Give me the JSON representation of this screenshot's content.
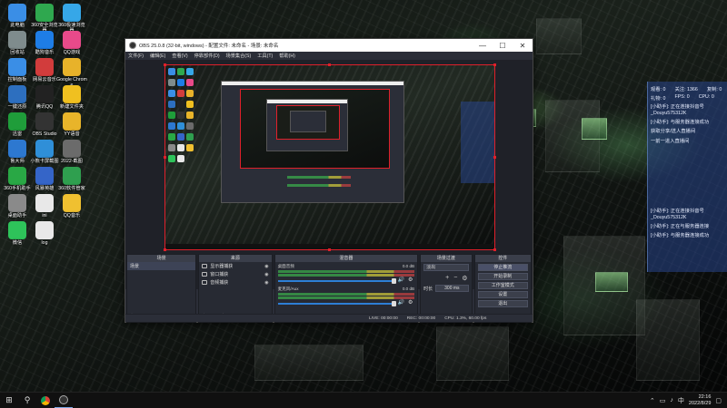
{
  "desktop_icons": [
    {
      "label": "此电脑",
      "icon": "computer-icon",
      "color": "#3a8ee6"
    },
    {
      "label": "360安全浏览器",
      "icon": "browser-icon",
      "color": "#2fa84f"
    },
    {
      "label": "360极速浏览器",
      "icon": "browser-icon",
      "color": "#36a7e8"
    },
    {
      "label": "回收站",
      "icon": "recycle-bin-icon",
      "color": "#7f8c8d"
    },
    {
      "label": "酷狗音乐",
      "icon": "music-icon",
      "color": "#1e7de6"
    },
    {
      "label": "QQ游戏",
      "icon": "game-icon",
      "color": "#e84a8a"
    },
    {
      "label": "控制面板",
      "icon": "control-panel-icon",
      "color": "#3a8ee6"
    },
    {
      "label": "网易云音乐",
      "icon": "music-icon",
      "color": "#d23c3c"
    },
    {
      "label": "Google Chrome",
      "icon": "chrome-icon",
      "color": "#e8b22a"
    },
    {
      "label": "一键还原",
      "icon": "restore-icon",
      "color": "#2d6fbf"
    },
    {
      "label": "腾讯QQ",
      "icon": "qq-icon",
      "color": "#222222"
    },
    {
      "label": "新建文件夹",
      "icon": "star-icon",
      "color": "#f0c020"
    },
    {
      "label": "迅雷",
      "icon": "thunder-icon",
      "color": "#1f9d3a"
    },
    {
      "label": "OBS Studio",
      "icon": "obs-icon",
      "color": "#333333"
    },
    {
      "label": "YY语音",
      "icon": "yy-icon",
      "color": "#e8b42a"
    },
    {
      "label": "鲁大师",
      "icon": "tool-icon",
      "color": "#2d78d0"
    },
    {
      "label": "小熊卡屏截图",
      "icon": "screenshot-icon",
      "color": "#2f8fd8"
    },
    {
      "label": "2022-截图",
      "icon": "image-icon",
      "color": "#6b6b6b"
    },
    {
      "label": "360手机助手",
      "icon": "plus-icon",
      "color": "#29a845"
    },
    {
      "label": "风暴英雄",
      "icon": "game-icon",
      "color": "#3565c8"
    },
    {
      "label": "360软件管家",
      "icon": "shield-icon",
      "color": "#2f9f4f"
    },
    {
      "label": "桌面助手",
      "icon": "assistant-icon",
      "color": "#8a8a8a"
    },
    {
      "label": "ini",
      "icon": "file-icon",
      "color": "#e8e8e8"
    },
    {
      "label": "QQ音乐",
      "icon": "qqmusic-icon",
      "color": "#f0c030"
    },
    {
      "label": "微信",
      "icon": "wechat-icon",
      "color": "#2ec35a"
    },
    {
      "label": "log",
      "icon": "file-icon",
      "color": "#e8e8e8"
    }
  ],
  "obs": {
    "title": "OBS 25.0.8 (32-bit, windows) - 配置文件: 未命名 - 场景: 未命名",
    "menu": [
      "文件(F)",
      "编辑(E)",
      "查看(V)",
      "停靠部件(D)",
      "场景集合(S)",
      "工具(T)",
      "帮助(H)"
    ],
    "window_buttons": {
      "minimize": "—",
      "maximize": "☐",
      "close": "✕"
    },
    "docks": {
      "scenes": {
        "header": "场景",
        "items": [
          "场景"
        ]
      },
      "sources": {
        "header": "来源",
        "items": [
          "显示器捕获",
          "窗口捕获",
          "音频捕获"
        ]
      },
      "mixer": {
        "header": "混音器",
        "tracks": [
          {
            "name": "桌面音频",
            "db": "0.0 dB"
          },
          {
            "name": "麦克风/Aux",
            "db": "0.0 dB"
          }
        ]
      },
      "transitions": {
        "header": "场景过渡",
        "type": "淡出",
        "duration_label": "时长",
        "duration": "300 ms"
      },
      "controls": {
        "header": "控件",
        "buttons": [
          "停止推流",
          "开始录制",
          "工作室模式",
          "设置",
          "退出"
        ]
      }
    },
    "status": {
      "live": "LIVE: 00:00:00",
      "rec": "REC: 00:00:00",
      "cpu": "CPU: 1.3%, 60.00 fps"
    }
  },
  "chat": {
    "stats": [
      "观看: 0",
      "关注: 1366",
      "复制: 0"
    ],
    "stats2": [
      "礼物: 0",
      "FPS: 0",
      "CPU: 0"
    ],
    "messages": [
      "[小助手]: 正在连接抖音号_Douyu575312K",
      "[小助手]: 与服务器连接成功",
      "获取分享/送人直播间",
      "一前一进入直播间",
      "[小助手]: 正在连接抖音号_Douyu575312K",
      "[小助手]: 正在与服务器连接",
      "[小助手]: 与服务器连接成功"
    ]
  },
  "taskbar": {
    "start": "⊞",
    "search": "⚲",
    "time": "22:16",
    "date": "2022/8/29"
  }
}
